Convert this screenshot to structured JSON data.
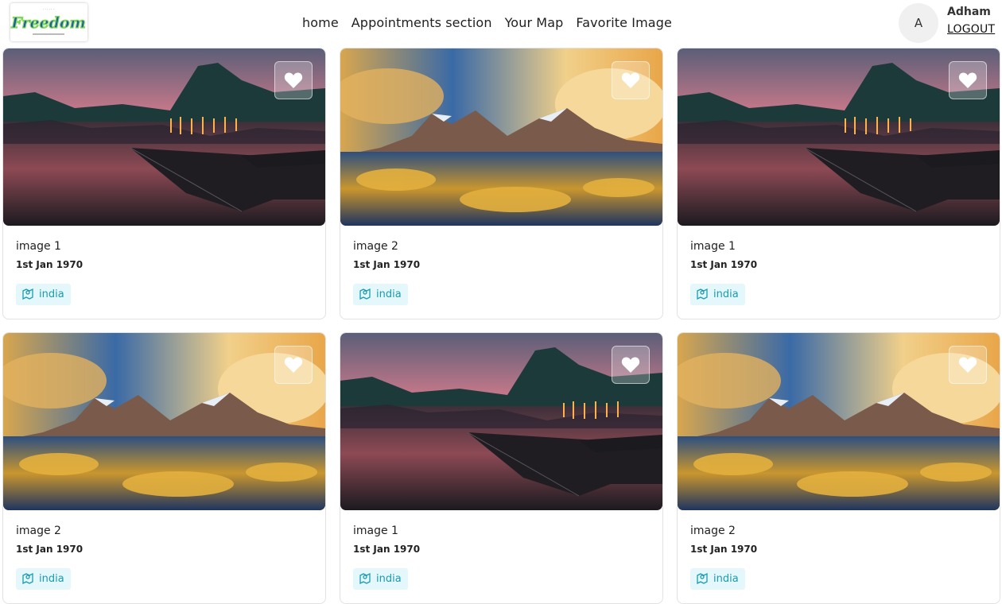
{
  "header": {
    "logo_text": "Freedom",
    "nav": [
      "home",
      "Appointments section",
      "Your Map",
      "Favorite Image"
    ],
    "user": {
      "avatar_letter": "A",
      "name": "Adham",
      "logout_label": "LOGOUT"
    }
  },
  "cards": [
    {
      "title": "image 1",
      "date": "1st Jan 1970",
      "tag": "india",
      "scene": "lake-dusk"
    },
    {
      "title": "image 2",
      "date": "1st Jan 1970",
      "tag": "india",
      "scene": "mountain-golden"
    },
    {
      "title": "image 1",
      "date": "1st Jan 1970",
      "tag": "india",
      "scene": "lake-dusk"
    },
    {
      "title": "image 2",
      "date": "1st Jan 1970",
      "tag": "india",
      "scene": "mountain-golden"
    },
    {
      "title": "image 1",
      "date": "1st Jan 1970",
      "tag": "india",
      "scene": "lake-dusk"
    },
    {
      "title": "image 2",
      "date": "1st Jan 1970",
      "tag": "india",
      "scene": "mountain-golden"
    }
  ],
  "colors": {
    "tag_bg": "#e4f7fb",
    "tag_text": "#1a9bb0"
  }
}
